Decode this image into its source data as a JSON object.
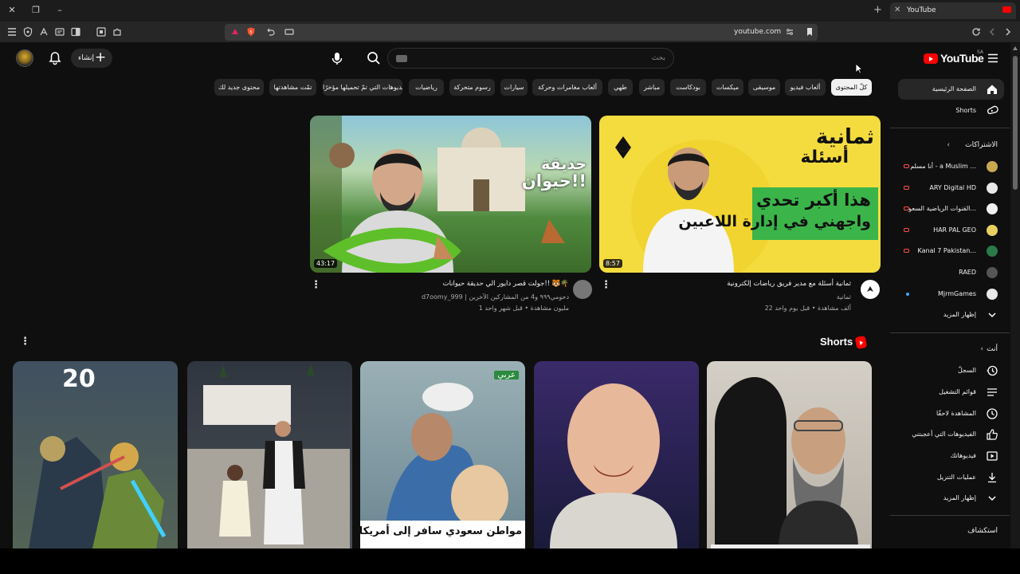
{
  "browser": {
    "tab_title": "YouTube",
    "url": "youtube.com",
    "new_tab": "+",
    "tab_close": "✕"
  },
  "masthead": {
    "logo_text": "YouTube",
    "country_code": "SA",
    "search_placeholder": "بحث",
    "create_label": "إنشاء"
  },
  "chips": [
    {
      "label": "كلّ المحتوى",
      "active": true
    },
    {
      "label": "ألعاب فيديو"
    },
    {
      "label": "موسيقى"
    },
    {
      "label": "ميكسات"
    },
    {
      "label": "بودكاست"
    },
    {
      "label": "مباشر"
    },
    {
      "label": "طهي"
    },
    {
      "label": "ألعاب مغامرات وحركة"
    },
    {
      "label": "سيارات"
    },
    {
      "label": "رسوم متحركة"
    },
    {
      "label": "رياضيات"
    },
    {
      "label": "الفيديوهات التي تمّ تحميلها مؤخرًا"
    },
    {
      "label": "تمّت مشاهدتها"
    },
    {
      "label": "محتوى جديد لك"
    }
  ],
  "sidebar": {
    "home": "الصفحة الرئيسية",
    "shorts": "Shorts",
    "subscriptions_header": "الاشتراكات",
    "subscriptions": [
      {
        "name": "أنا مسلم - a Muslim ...",
        "live": true
      },
      {
        "name": "ARY Digital HD",
        "live": true
      },
      {
        "name": "القنوات الرياضية السعو...",
        "live": true
      },
      {
        "name": "HAR PAL GEO",
        "live": true
      },
      {
        "name": "Kanal 7 Pakistan...",
        "live": true
      },
      {
        "name": "RAED"
      },
      {
        "name": "MjrmGames",
        "dot": true
      }
    ],
    "show_more_1": "إظهار المزيد",
    "you_header": "أنت",
    "you_items": [
      {
        "label": "السجلّ",
        "icon": "history-icon"
      },
      {
        "label": "قوائم التشغيل",
        "icon": "playlists-icon"
      },
      {
        "label": "المشاهدة لاحقًا",
        "icon": "watch-later-icon"
      },
      {
        "label": "الفيديوهات التي أعجبتني",
        "icon": "like-icon"
      },
      {
        "label": "فيديوهاتك",
        "icon": "your-videos-icon"
      },
      {
        "label": "عمليات التنزيل",
        "icon": "download-icon"
      }
    ],
    "show_more_2": "إظهار المزيد",
    "explore_header": "استكشاف"
  },
  "videos": [
    {
      "title": "ثمانية أسئلة مع مدير فريق رياضات إلكترونية",
      "channel": "ثمانية",
      "stats": "22 ألف مشاهدة • قبل يوم واحد",
      "duration": "8:57",
      "thumb_text_1": "ثمانية",
      "thumb_text_2": "أسئلة",
      "thumb_text_3": "هذا أكبر تحدي",
      "thumb_text_4": "واجهني في إدارة اللاعبين"
    },
    {
      "title": "جولت قصر دايور الي حديقة حيوانات!! 🐯🌴",
      "channel": "d7oomy_999 | دحومي٩٩٩ و4 من المشاركين الآخرين",
      "stats": "1 مليون مشاهدة • قبل شهر واحد",
      "duration": "43:17",
      "thumb_text_1": "حديقة",
      "thumb_text_2": "حيوان!!"
    }
  ],
  "shorts": {
    "title": "Shorts",
    "items": [
      {
        "overlay": ""
      },
      {
        "overlay": ""
      },
      {
        "overlay": "مواطن سعودي سافر إلى أمريكا للقاء",
        "badge": "عربي"
      },
      {
        "overlay": ""
      },
      {
        "overlay": "20"
      }
    ]
  },
  "colors": {
    "background": "#0f0f0f",
    "accent_red": "#ff0000",
    "chip_bg": "#272727",
    "thumb_yellow": "#f5dc3e",
    "thumb_green": "#3bb54a"
  }
}
